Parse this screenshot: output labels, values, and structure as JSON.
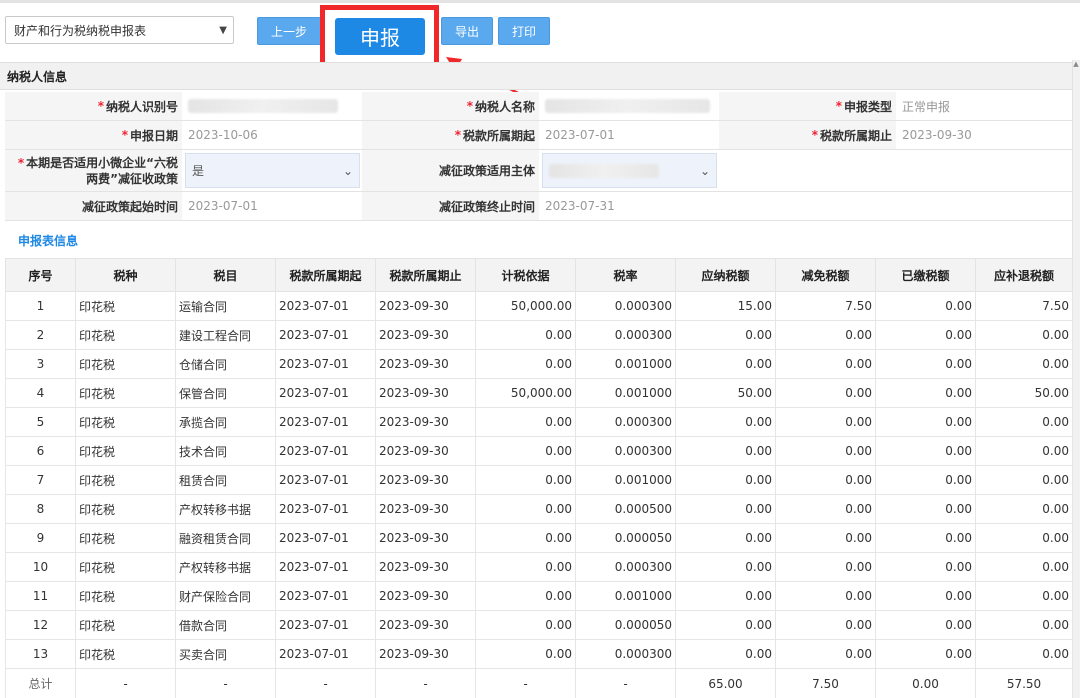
{
  "toolbar": {
    "form_select": "财产和行为税纳税申报表",
    "prev_label": "上一步",
    "submit_label": "申报",
    "export_label": "导出",
    "print_label": "打印"
  },
  "taxpayer": {
    "section_title": "纳税人信息",
    "id_label": "纳税人识别号",
    "name_label": "纳税人名称",
    "decl_type_label": "申报类型",
    "decl_type_value": "正常申报",
    "decl_date_label": "申报日期",
    "decl_date_value": "2023-10-06",
    "period_start_label": "税款所属期起",
    "period_start_value": "2023-07-01",
    "period_end_label": "税款所属期止",
    "period_end_value": "2023-09-30",
    "small_biz_label_1": "本期是否适用小微企业“六税",
    "small_biz_label_2": "两费”减征收政策",
    "small_biz_value": "是",
    "relief_subject_label": "减征政策适用主体",
    "relief_start_label": "减征政策起始时间",
    "relief_start_value": "2023-07-01",
    "relief_end_label": "减征政策终止时间",
    "relief_end_value": "2023-07-31"
  },
  "table": {
    "title": "申报表信息",
    "headers": [
      "序号",
      "税种",
      "税目",
      "税款所属期起",
      "税款所属期止",
      "计税依据",
      "税率",
      "应纳税额",
      "减免税额",
      "已缴税额",
      "应补退税额"
    ],
    "rows": [
      [
        "1",
        "印花税",
        "运输合同",
        "2023-07-01",
        "2023-09-30",
        "50,000.00",
        "0.000300",
        "15.00",
        "7.50",
        "0.00",
        "7.50"
      ],
      [
        "2",
        "印花税",
        "建设工程合同",
        "2023-07-01",
        "2023-09-30",
        "0.00",
        "0.000300",
        "0.00",
        "0.00",
        "0.00",
        "0.00"
      ],
      [
        "3",
        "印花税",
        "仓储合同",
        "2023-07-01",
        "2023-09-30",
        "0.00",
        "0.001000",
        "0.00",
        "0.00",
        "0.00",
        "0.00"
      ],
      [
        "4",
        "印花税",
        "保管合同",
        "2023-07-01",
        "2023-09-30",
        "50,000.00",
        "0.001000",
        "50.00",
        "0.00",
        "0.00",
        "50.00"
      ],
      [
        "5",
        "印花税",
        "承揽合同",
        "2023-07-01",
        "2023-09-30",
        "0.00",
        "0.000300",
        "0.00",
        "0.00",
        "0.00",
        "0.00"
      ],
      [
        "6",
        "印花税",
        "技术合同",
        "2023-07-01",
        "2023-09-30",
        "0.00",
        "0.000300",
        "0.00",
        "0.00",
        "0.00",
        "0.00"
      ],
      [
        "7",
        "印花税",
        "租赁合同",
        "2023-07-01",
        "2023-09-30",
        "0.00",
        "0.001000",
        "0.00",
        "0.00",
        "0.00",
        "0.00"
      ],
      [
        "8",
        "印花税",
        "产权转移书据",
        "2023-07-01",
        "2023-09-30",
        "0.00",
        "0.000500",
        "0.00",
        "0.00",
        "0.00",
        "0.00"
      ],
      [
        "9",
        "印花税",
        "融资租赁合同",
        "2023-07-01",
        "2023-09-30",
        "0.00",
        "0.000050",
        "0.00",
        "0.00",
        "0.00",
        "0.00"
      ],
      [
        "10",
        "印花税",
        "产权转移书据",
        "2023-07-01",
        "2023-09-30",
        "0.00",
        "0.000300",
        "0.00",
        "0.00",
        "0.00",
        "0.00"
      ],
      [
        "11",
        "印花税",
        "财产保险合同",
        "2023-07-01",
        "2023-09-30",
        "0.00",
        "0.001000",
        "0.00",
        "0.00",
        "0.00",
        "0.00"
      ],
      [
        "12",
        "印花税",
        "借款合同",
        "2023-07-01",
        "2023-09-30",
        "0.00",
        "0.000050",
        "0.00",
        "0.00",
        "0.00",
        "0.00"
      ],
      [
        "13",
        "印花税",
        "买卖合同",
        "2023-07-01",
        "2023-09-30",
        "0.00",
        "0.000300",
        "0.00",
        "0.00",
        "0.00",
        "0.00"
      ]
    ],
    "total": [
      "总计",
      "-",
      "-",
      "-",
      "-",
      "-",
      "-",
      "65.00",
      "7.50",
      "0.00",
      "57.50"
    ]
  },
  "colors": {
    "accent": "#1e88e5",
    "button": "#5aa9ef",
    "highlight": "#f0282a"
  }
}
